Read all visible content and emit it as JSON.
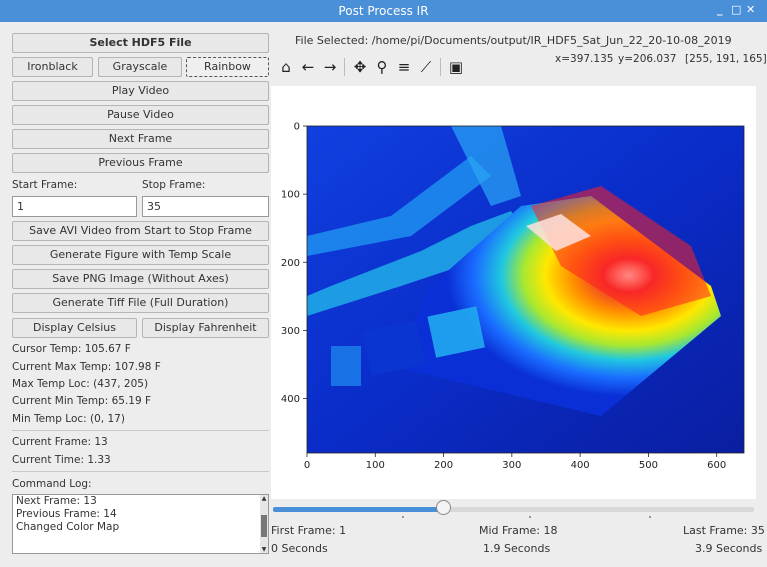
{
  "window": {
    "title": "Post Process IR",
    "min": "_",
    "max": "□",
    "close": "✕"
  },
  "controls": {
    "select_file": "Select HDF5 File",
    "colormaps": [
      "Ironblack",
      "Grayscale",
      "Rainbow"
    ],
    "play": "Play Video",
    "pause": "Pause Video",
    "next": "Next Frame",
    "previous": "Previous Frame",
    "start_label": "Start Frame:",
    "stop_label": "Stop Frame:",
    "start_value": "1",
    "stop_value": "35",
    "save_avi": "Save AVI Video from Start to Stop Frame",
    "gen_figure": "Generate Figure with Temp Scale",
    "save_png": "Save PNG Image (Without Axes)",
    "gen_tiff": "Generate Tiff File (Full Duration)",
    "celsius": "Display Celsius",
    "fahrenheit": "Display Fahrenheit"
  },
  "stats": {
    "cursor_temp": "Cursor Temp: 105.67 F",
    "max_temp": "Current Max Temp: 107.98 F",
    "max_loc": "Max Temp Loc: (437, 205)",
    "min_temp": "Current Min Temp: 65.19 F",
    "min_loc": "Min Temp Loc: (0, 17)",
    "frame": "Current Frame: 13",
    "time": "Current Time: 1.33"
  },
  "log": {
    "label": "Command Log:",
    "lines": [
      "Next Frame: 13",
      "Previous Frame: 14",
      "Changed Color Map"
    ]
  },
  "file": {
    "selected": "File Selected:  /home/pi/Documents/output/IR_HDF5_Sat_Jun_22_20-10-08_2019"
  },
  "readout": {
    "x": "x=397.135",
    "y": "y=206.037",
    "rgb": "[255, 191, 165]"
  },
  "toolbar": {
    "icons": [
      "home-icon",
      "back-arrow-icon",
      "forward-arrow-icon",
      "pan-icon",
      "zoom-icon",
      "configure-icon",
      "edit-axes-icon",
      "save-icon"
    ],
    "glyphs": [
      "⌂",
      "←",
      "→",
      "✥",
      "⚲",
      "≡",
      "⟋",
      "▣"
    ]
  },
  "plot": {
    "x_ticks": [
      "0",
      "100",
      "200",
      "300",
      "400",
      "500",
      "600"
    ],
    "x_values": [
      0,
      100,
      200,
      300,
      400,
      500,
      600
    ],
    "y_ticks": [
      "0",
      "100",
      "200",
      "300",
      "400"
    ],
    "y_values": [
      0,
      100,
      200,
      300,
      400
    ],
    "xlim": [
      0,
      640
    ],
    "ylim": [
      0,
      480
    ],
    "colormap": "Rainbow"
  },
  "timeline": {
    "first": "First Frame: 1",
    "mid": "Mid Frame: 18",
    "last": "Last Frame: 35",
    "start_time": "0 Seconds",
    "mid_time": "1.9 Seconds",
    "end_time": "3.9 Seconds",
    "current_frame": 13,
    "total_frames": 35,
    "accent": "#4a90d9"
  }
}
